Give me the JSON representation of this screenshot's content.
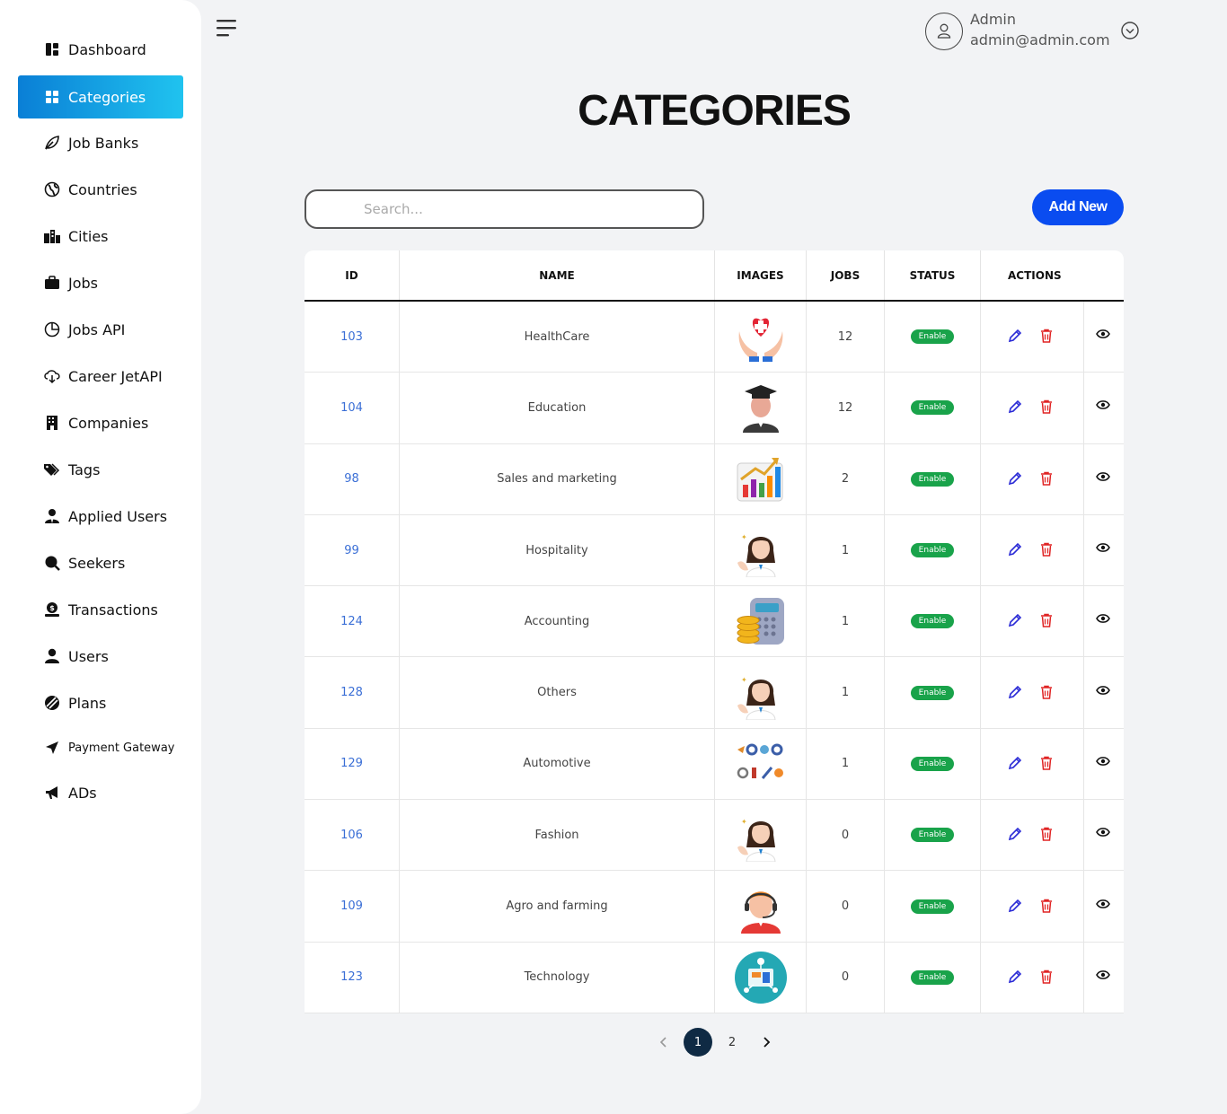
{
  "sidebar": {
    "items": [
      {
        "label": "Dashboard",
        "icon": "dashboard-icon"
      },
      {
        "label": "Categories",
        "icon": "grid-icon",
        "active": true
      },
      {
        "label": "Job Banks",
        "icon": "leaf-icon"
      },
      {
        "label": "Countries",
        "icon": "globe-icon"
      },
      {
        "label": "Cities",
        "icon": "city-icon"
      },
      {
        "label": "Jobs",
        "icon": "briefcase-icon"
      },
      {
        "label": "Jobs API",
        "icon": "pie-chart-icon"
      },
      {
        "label": "Career JetAPI",
        "icon": "cloud-download-icon"
      },
      {
        "label": "Companies",
        "icon": "building-icon"
      },
      {
        "label": "Tags",
        "icon": "tags-icon"
      },
      {
        "label": "Applied Users",
        "icon": "user-tie-icon"
      },
      {
        "label": "Seekers",
        "icon": "search-icon"
      },
      {
        "label": "Transactions",
        "icon": "money-icon"
      },
      {
        "label": "Users",
        "icon": "user-icon"
      },
      {
        "label": "Plans",
        "icon": "plans-icon"
      },
      {
        "label": "Payment Gateway",
        "icon": "send-icon"
      },
      {
        "label": "ADs",
        "icon": "megaphone-icon"
      }
    ]
  },
  "header": {
    "user_name": "Admin",
    "user_email": "admin@admin.com"
  },
  "page": {
    "title": "CATEGORIES",
    "search_placeholder": "Search...",
    "add_button": "Add New"
  },
  "table": {
    "columns": [
      "ID",
      "NAME",
      "IMAGES",
      "JOBS",
      "STATUS",
      "ACTIONS"
    ],
    "rows": [
      {
        "id": "103",
        "name": "HealthCare",
        "image": "healthcare-icon",
        "jobs": "12",
        "status": "Enable"
      },
      {
        "id": "104",
        "name": "Education",
        "image": "graduate-icon",
        "jobs": "12",
        "status": "Enable"
      },
      {
        "id": "98",
        "name": "Sales and marketing",
        "image": "sales-chart-icon",
        "jobs": "2",
        "status": "Enable"
      },
      {
        "id": "99",
        "name": "Hospitality",
        "image": "hostess-icon",
        "jobs": "1",
        "status": "Enable"
      },
      {
        "id": "124",
        "name": "Accounting",
        "image": "calculator-coins-icon",
        "jobs": "1",
        "status": "Enable"
      },
      {
        "id": "128",
        "name": "Others",
        "image": "hostess-icon",
        "jobs": "1",
        "status": "Enable"
      },
      {
        "id": "129",
        "name": "Automotive",
        "image": "auto-parts-icon",
        "jobs": "1",
        "status": "Enable"
      },
      {
        "id": "106",
        "name": "Fashion",
        "image": "hostess-icon",
        "jobs": "0",
        "status": "Enable"
      },
      {
        "id": "109",
        "name": "Agro and farming",
        "image": "support-agent-icon",
        "jobs": "0",
        "status": "Enable"
      },
      {
        "id": "123",
        "name": "Technology",
        "image": "technology-icon",
        "jobs": "0",
        "status": "Enable"
      }
    ]
  },
  "pagination": {
    "pages": [
      "1",
      "2"
    ],
    "current": "1"
  },
  "colors": {
    "accent": "#0a4cf0",
    "active_gradient_start": "#0a7fd6",
    "active_gradient_end": "#20c3ef",
    "status_enable": "#19a34a",
    "id_link": "#3b6fd6",
    "edit_icon": "#2a2ad6",
    "delete_icon": "#e02424"
  }
}
